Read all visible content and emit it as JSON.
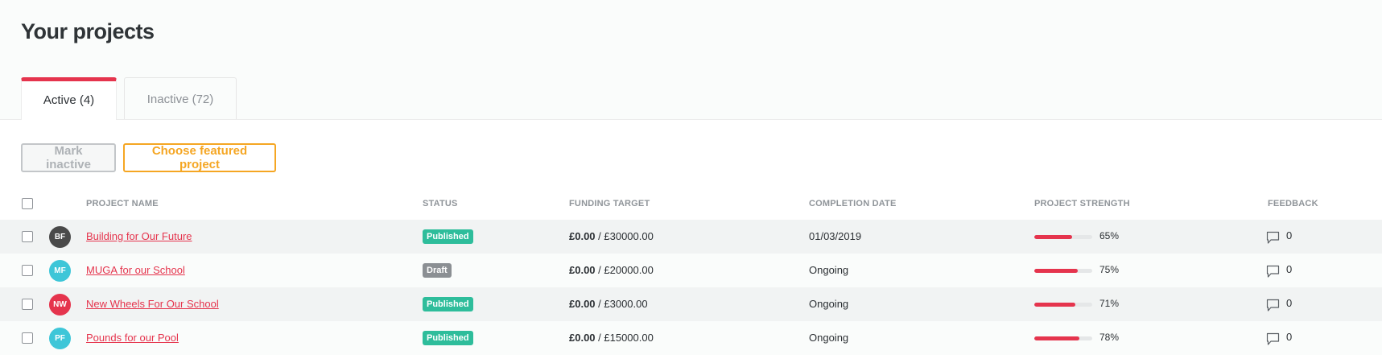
{
  "page": {
    "title": "Your projects"
  },
  "tabs": [
    {
      "label": "Active (4)",
      "active": true
    },
    {
      "label": "Inactive (72)",
      "active": false
    }
  ],
  "actions": {
    "mark_inactive": "Mark inactive",
    "choose_featured": "Choose featured project"
  },
  "table": {
    "headers": {
      "name": "PROJECT NAME",
      "status": "STATUS",
      "funding": "FUNDING TARGET",
      "completion": "COMPLETION DATE",
      "strength": "PROJECT STRENGTH",
      "feedback": "FEEDBACK"
    },
    "rows": [
      {
        "initials": "BF",
        "avatar_color": "#4a4a4a",
        "name": "Building for Our Future",
        "status": "Published",
        "status_color": "#2ebd9b",
        "raised": "£0.00",
        "target": " / £30000.00",
        "completion": "01/03/2019",
        "strength": 65,
        "strength_label": "65%",
        "feedback": "0"
      },
      {
        "initials": "MF",
        "avatar_color": "#3ec6d8",
        "name": "MUGA for our School",
        "status": "Draft",
        "status_color": "#8b8f93",
        "raised": "£0.00",
        "target": " / £20000.00",
        "completion": "Ongoing",
        "strength": 75,
        "strength_label": "75%",
        "feedback": "0"
      },
      {
        "initials": "NW",
        "avatar_color": "#e5344d",
        "name": "New Wheels For Our School",
        "status": "Published",
        "status_color": "#2ebd9b",
        "raised": "£0.00",
        "target": " / £3000.00",
        "completion": "Ongoing",
        "strength": 71,
        "strength_label": "71%",
        "feedback": "0"
      },
      {
        "initials": "PF",
        "avatar_color": "#3ec6d8",
        "name": "Pounds for our Pool",
        "status": "Published",
        "status_color": "#2ebd9b",
        "raised": "£0.00",
        "target": " / £15000.00",
        "completion": "Ongoing",
        "strength": 78,
        "strength_label": "78%",
        "feedback": "0"
      }
    ]
  },
  "icons": {
    "feedback": "speech-bubble-icon"
  }
}
